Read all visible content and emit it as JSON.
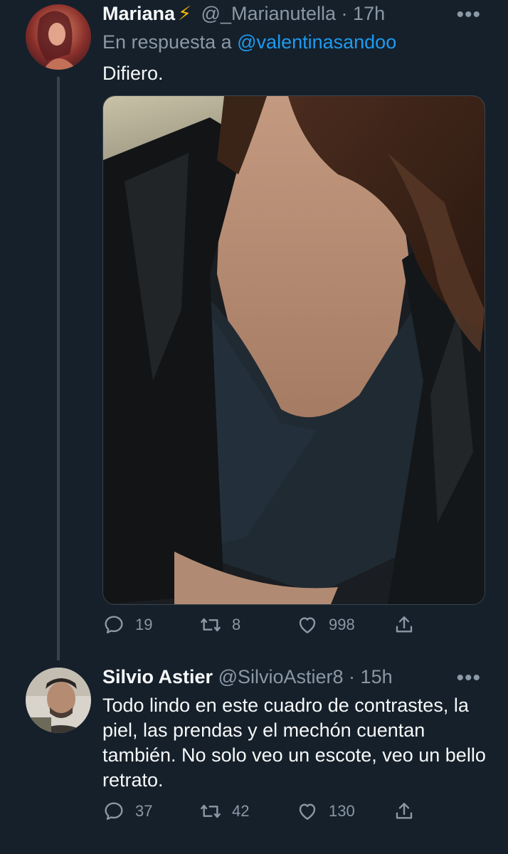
{
  "tweets": [
    {
      "name": "Mariana",
      "emoji": "⚡",
      "handle": "@_Marianutella",
      "time": "17h",
      "reply_prefix": "En respuesta a",
      "reply_handle": "@valentinasandoo",
      "text": "Difiero.",
      "replies": "19",
      "retweets": "8",
      "likes": "998"
    },
    {
      "name": "Silvio Astier",
      "handle": "@SilvioAstier8",
      "time": "15h",
      "text": "Todo lindo en este cuadro de contrastes, la piel, las prendas y el mechón cuentan también. No solo veo un escote, veo un bello retrato.",
      "replies": "37",
      "retweets": "42",
      "likes": "130"
    }
  ],
  "icons": {
    "reply": "reply-icon",
    "retweet": "retweet-icon",
    "like": "heart-icon",
    "share": "share-icon",
    "more": "more-icon"
  },
  "colors": {
    "background": "#15202b",
    "link": "#1d9bf0",
    "muted": "#8b98a5",
    "lightning": "#f5b800"
  }
}
